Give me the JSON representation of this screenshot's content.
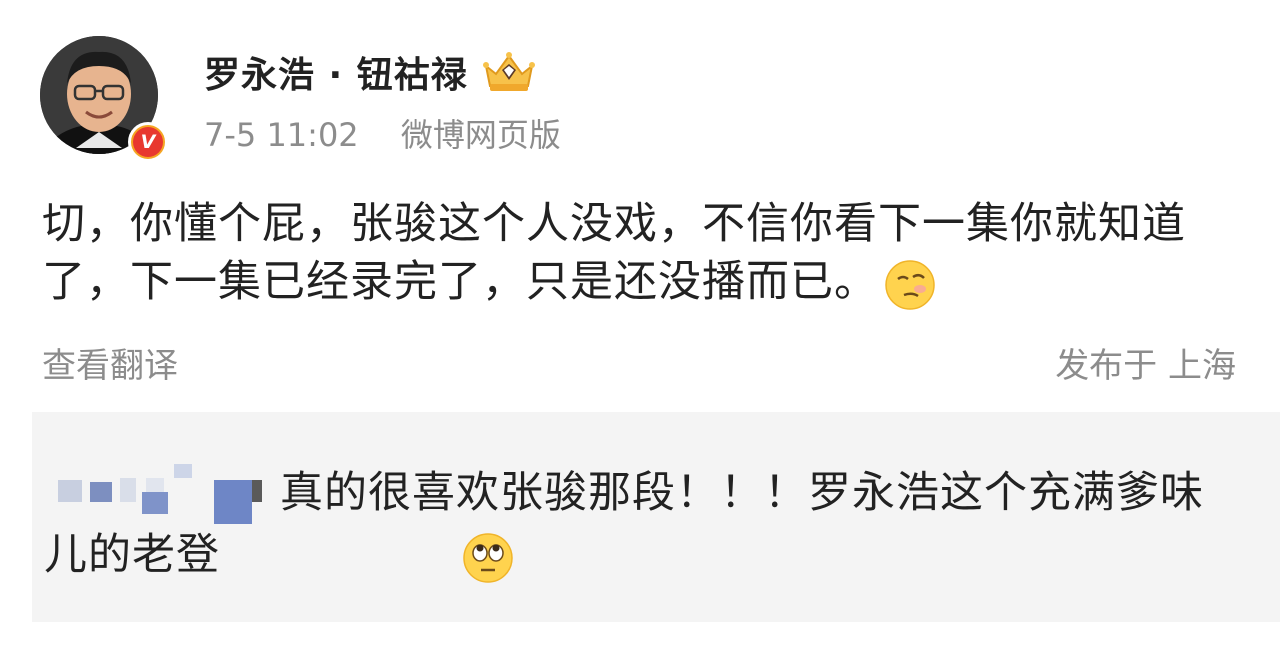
{
  "post": {
    "username": "罗永浩 · 钮祜禄",
    "timestamp": "7-5 11:02",
    "source": "微博网页版",
    "text": "切，你懂个屁，张骏这个人没戏，不信你看下一集你就知道了，下一集已经录完了，只是还没播而已。",
    "emoji": "smirk-emoji",
    "translate_label": "查看翻译",
    "location": "发布于 上海",
    "verified_badge": "V",
    "badge_icon": "crown-vip-icon"
  },
  "comment": {
    "author_blurred": true,
    "text": "真的很喜欢张骏那段！！！罗永浩这个充满爹味儿的老登",
    "emoji": "eye-roll-emoji"
  },
  "colors": {
    "meta_gray": "#8c8c8c",
    "badge_red": "#e8382f",
    "badge_gold": "#f5a623",
    "comment_bg": "#f4f4f4"
  }
}
